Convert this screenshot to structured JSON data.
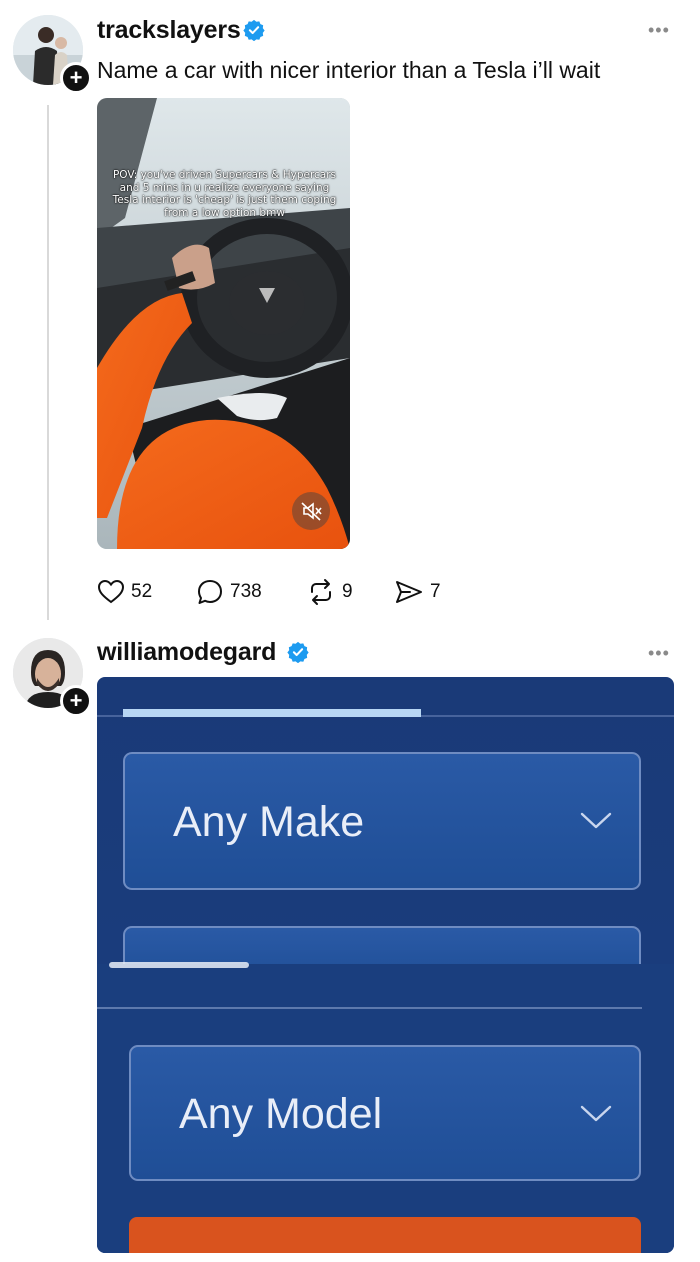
{
  "post1": {
    "username": "trackslayers",
    "caption": "Name a car with nicer interior than a Tesla i’ll wait",
    "more_label": "•••",
    "follow_symbol": "+",
    "video_overlay_text": "POV: you've driven Supercars & Hypercars and 5 mins in u realize everyone saying Tesla interior is 'cheap' is just them coping from a low option bmw",
    "actions": {
      "likes": "52",
      "comments": "738",
      "reposts": "9",
      "shares": "7"
    }
  },
  "post2": {
    "username": "williamodegard",
    "more_label": "•••",
    "follow_symbol": "+",
    "screenshot": {
      "make_select": "Any Make",
      "model_select": "Any Model"
    }
  },
  "colors": {
    "verified": "#1d9bf0",
    "shot_blue": "#1a3f80",
    "button_orange": "#d9531e"
  },
  "icons": [
    "verified-badge-icon",
    "heart-icon",
    "comment-icon",
    "repost-icon",
    "share-icon",
    "more-icon",
    "chevron-down-icon",
    "mute-icon"
  ]
}
